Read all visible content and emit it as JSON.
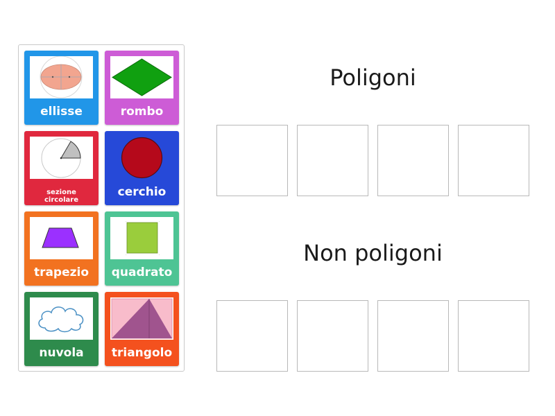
{
  "groups": [
    {
      "title": "Poligoni",
      "slot_count": 4
    },
    {
      "title": "Non poligoni",
      "slot_count": 4
    }
  ],
  "cards": [
    {
      "label": "ellisse",
      "color": "#2196e8",
      "icon": "ellipse-icon"
    },
    {
      "label": "rombo",
      "color": "#cd5cd6",
      "icon": "rhombus-icon"
    },
    {
      "label": "sezione circolare",
      "color": "#e0283e",
      "icon": "circular-sector-icon"
    },
    {
      "label": "cerchio",
      "color": "#2649d8",
      "icon": "circle-icon"
    },
    {
      "label": "trapezio",
      "color": "#f27220",
      "icon": "trapezoid-icon"
    },
    {
      "label": "quadrato",
      "color": "#4ec494",
      "icon": "square-icon"
    },
    {
      "label": "nuvola",
      "color": "#2e8b4c",
      "icon": "cloud-icon"
    },
    {
      "label": "triangolo",
      "color": "#f4511e",
      "icon": "triangle-icon"
    }
  ],
  "colors": {
    "ellipse_fill": "#f2a58f",
    "rhombus_fill": "#10a010",
    "sector_fill": "#c0c0c0",
    "circle_fill": "#b5091b",
    "trapezoid_fill": "#9b30ff",
    "square_fill": "#9acd3c",
    "cloud_stroke": "#4a90c4",
    "triangle_bg": "#f8bccb",
    "triangle_fill": "#a0548e"
  }
}
